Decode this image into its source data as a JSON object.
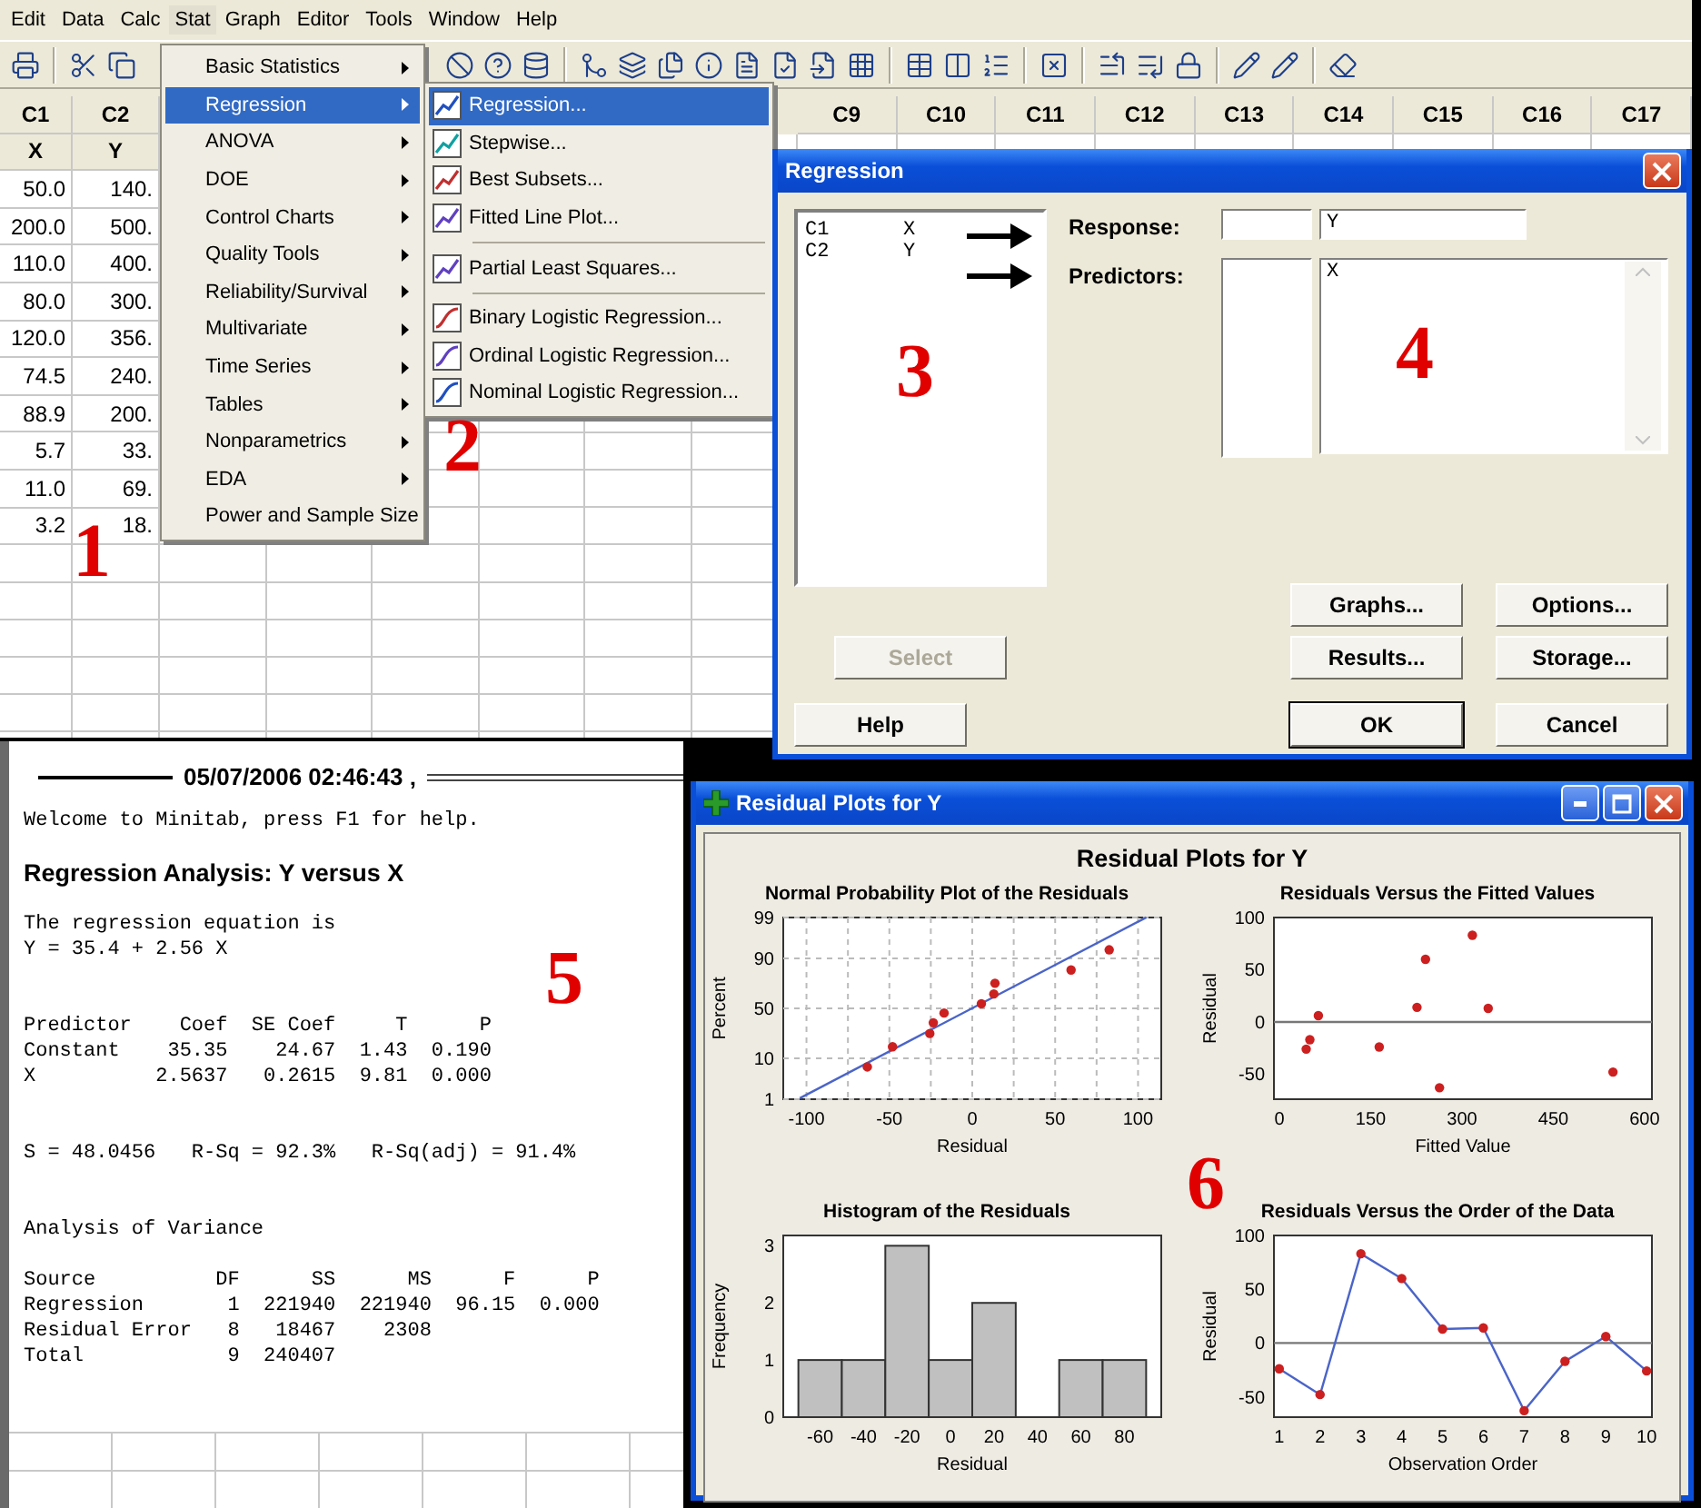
{
  "menu_bar": [
    {
      "label": "Edit",
      "selected": false
    },
    {
      "label": "Data",
      "selected": false
    },
    {
      "label": "Calc",
      "selected": false
    },
    {
      "label": "Stat",
      "selected": true
    },
    {
      "label": "Graph",
      "selected": false
    },
    {
      "label": "Editor",
      "selected": false
    },
    {
      "label": "Tools",
      "selected": false
    },
    {
      "label": "Window",
      "selected": false
    },
    {
      "label": "Help",
      "selected": false
    }
  ],
  "worksheet": {
    "columns": [
      {
        "label": "C1",
        "name": "X",
        "values": [
          "50.0",
          "200.0",
          "110.0",
          "80.0",
          "120.0",
          "74.5",
          "88.9",
          "5.7",
          "11.0",
          "3.2"
        ]
      },
      {
        "label": "C2",
        "name": "Y",
        "values": [
          "140.",
          "500.",
          "400.",
          "300.",
          "356.",
          "240.",
          "200.",
          "33.",
          "69.",
          "18."
        ]
      }
    ],
    "more_columns": [
      "C9",
      "C10",
      "C11",
      "C12",
      "C13",
      "C14",
      "C15",
      "C16",
      "C17"
    ]
  },
  "stat_menu": [
    {
      "label": "Basic Statistics",
      "selected": false
    },
    {
      "label": "Regression",
      "selected": true
    },
    {
      "label": "ANOVA",
      "selected": false
    },
    {
      "label": "DOE",
      "selected": false
    },
    {
      "label": "Control Charts",
      "selected": false
    },
    {
      "label": "Quality Tools",
      "selected": false
    },
    {
      "label": "Reliability/Survival",
      "selected": false
    },
    {
      "label": "Multivariate",
      "selected": false
    },
    {
      "label": "Time Series",
      "selected": false
    },
    {
      "label": "Tables",
      "selected": false
    },
    {
      "label": "Nonparametrics",
      "selected": false
    },
    {
      "label": "EDA",
      "selected": false
    },
    {
      "label": "Power and Sample Size",
      "selected": false
    }
  ],
  "regression_submenu": [
    [
      {
        "label": "Regression...",
        "selected": true
      },
      {
        "label": "Stepwise...",
        "selected": false
      },
      {
        "label": "Best Subsets...",
        "selected": false
      },
      {
        "label": "Fitted Line Plot...",
        "selected": false
      }
    ],
    [
      {
        "label": "Partial Least Squares...",
        "selected": false
      }
    ],
    [
      {
        "label": "Binary Logistic Regression...",
        "selected": false
      },
      {
        "label": "Ordinal Logistic Regression...",
        "selected": false
      },
      {
        "label": "Nominal Logistic Regression...",
        "selected": false
      }
    ]
  ],
  "dialog": {
    "title": "Regression",
    "variables": [
      {
        "column": "C1",
        "name": "X"
      },
      {
        "column": "C2",
        "name": "Y"
      }
    ],
    "response": {
      "label": "Response:",
      "value": "Y"
    },
    "predictors": {
      "label": "Predictors:",
      "value": "X"
    },
    "select_button": {
      "label": "Select",
      "disabled": true
    },
    "help_button": "Help",
    "option_buttons": [
      "Graphs...",
      "Options...",
      "Results...",
      "Storage..."
    ],
    "ok_button": {
      "label": "OK",
      "default": true
    },
    "cancel_button": "Cancel"
  },
  "session": {
    "timestamp": "05/07/2006 02:46:43 ‚",
    "blocks": [
      {
        "kind": "text",
        "lines": [
          "Welcome to Minitab, press F1 for help."
        ]
      },
      {
        "kind": "heading",
        "lines": [
          "Regression Analysis: Y versus X"
        ]
      },
      {
        "kind": "text",
        "lines": [
          "The regression equation is",
          "Y = 35.4 + 2.56 X"
        ]
      },
      {
        "kind": "text",
        "lines": [
          "Predictor    Coef  SE Coef     T      P",
          "Constant    35.35    24.67  1.43  0.190",
          "X          2.5637   0.2615  9.81  0.000"
        ]
      },
      {
        "kind": "text",
        "lines": [
          "S = 48.0456   R-Sq = 92.3%   R-Sq(adj) = 91.4%"
        ]
      },
      {
        "kind": "text",
        "lines": [
          "Analysis of Variance"
        ]
      },
      {
        "kind": "text",
        "lines": [
          "Source          DF      SS      MS      F      P",
          "Regression       1  221940  221940  96.15  0.000",
          "Residual Error   8   18467    2308",
          "Total            9  240407"
        ]
      }
    ]
  },
  "residual_window": {
    "title": "Residual Plots for Y",
    "heading": "Residual Plots for Y",
    "charts": [
      {
        "title": "Normal Probability Plot of the Residuals",
        "xlabel": "Residual",
        "ylabel": "Percent",
        "x_tick_labels": [
          "-100",
          "-50",
          "0",
          "50",
          "100"
        ],
        "y_tick_labels": [
          "99",
          "90",
          "50",
          "10",
          "1"
        ]
      },
      {
        "chart_data": {
          "type": "scatter",
          "title": "Residuals Versus the Fitted Values",
          "xlabel": "Fitted Value",
          "ylabel": "Residual",
          "x": [
            164,
            548,
            317,
            240,
            343,
            226,
            263,
            50,
            64,
            44
          ],
          "series": [
            {
              "color": "#cc2020",
              "values": [
                -24,
                -48,
                83,
                60,
                13,
                14,
                -63,
                -17,
                6,
                -26
              ]
            }
          ],
          "xlim": [
            -9,
            612
          ],
          "ylim": [
            -74,
            100
          ],
          "xticks": [
            0,
            150,
            300,
            450,
            600
          ],
          "yticks": [
            -50,
            0,
            50,
            100
          ],
          "ref_lines": [
            {
              "axis": "y",
              "value": 0
            }
          ]
        }
      },
      {
        "chart_data": {
          "type": "bar",
          "title": "Histogram of the Residuals",
          "xlabel": "Residual",
          "ylabel": "Frequency",
          "categories": [
            "-60",
            "-40",
            "-20",
            "0",
            "20",
            "40",
            "60",
            "80"
          ],
          "series": [
            {
              "color": "#c0c0c0",
              "values": [
                1,
                1,
                3,
                1,
                2,
                0,
                1,
                1
              ]
            }
          ],
          "ylim": [
            0,
            3.18
          ],
          "yticks": [
            0,
            1,
            2,
            3
          ]
        }
      },
      {
        "chart_data": {
          "type": "line",
          "title": "Residuals Versus the Order of the Data",
          "xlabel": "Observation Order",
          "ylabel": "Residual",
          "x": [
            1,
            2,
            3,
            4,
            5,
            6,
            7,
            8,
            9,
            10
          ],
          "series": [
            {
              "color": "#cc2020",
              "marker": "circle",
              "values": [
                -24,
                -48,
                83,
                60,
                13,
                14,
                -63,
                -17,
                6,
                -26
              ]
            }
          ],
          "xlim": [
            0.87,
            10.13
          ],
          "ylim": [
            -69,
            100
          ],
          "xticks": [
            1,
            2,
            3,
            4,
            5,
            6,
            7,
            8,
            9,
            10
          ],
          "yticks": [
            -50,
            0,
            50,
            100
          ],
          "ref_lines": [
            {
              "axis": "y",
              "value": 0
            }
          ]
        }
      }
    ]
  },
  "annotations": [
    "1",
    "2",
    "3",
    "4",
    "5",
    "6"
  ]
}
